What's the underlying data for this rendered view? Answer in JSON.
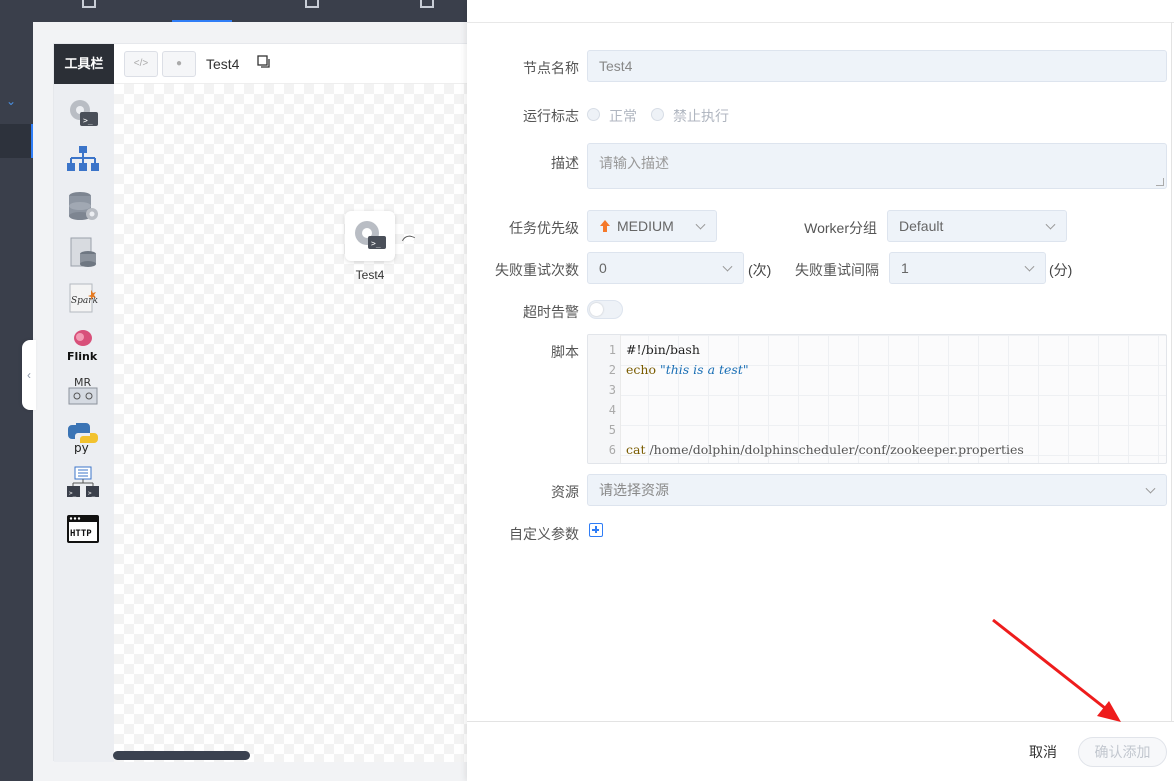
{
  "toolbar": {
    "title": "工具栏",
    "tools": [
      "shell-icon",
      "sub-process-icon",
      "procedure-icon",
      "sql-icon",
      "spark-icon",
      "flink-icon",
      "mr-icon",
      "python-icon",
      "dependent-icon",
      "http-icon"
    ],
    "flink_label": "Flink",
    "mr_label": "MR",
    "py_label": "py",
    "spark_label": "Spark",
    "http_label": "HTTP"
  },
  "dag": {
    "name": "Test4",
    "node_label": "Test4"
  },
  "form": {
    "node_name_label": "节点名称",
    "node_name_value": "Test4",
    "run_flag_label": "运行标志",
    "run_flag_normal": "正常",
    "run_flag_forbidden": "禁止执行",
    "desc_label": "描述",
    "desc_placeholder": "请输入描述",
    "priority_label": "任务优先级",
    "priority_value": "MEDIUM",
    "worker_group_label": "Worker分组",
    "worker_group_value": "Default",
    "retry_times_label": "失败重试次数",
    "retry_times_value": "0",
    "retry_times_unit": "(次)",
    "retry_interval_label": "失败重试间隔",
    "retry_interval_value": "1",
    "retry_interval_unit": "(分)",
    "timeout_label": "超时告警",
    "script_label": "脚本",
    "resource_label": "资源",
    "resource_placeholder": "请选择资源",
    "custom_params_label": "自定义参数"
  },
  "script": {
    "line_numbers": [
      "1",
      "2",
      "3",
      "4",
      "5",
      "6"
    ],
    "line1": "#!/bin/bash",
    "line2_kw": "echo",
    "line2_str": "\"this is a test\"",
    "line6_kw": "cat",
    "line6_path": "/home/dolphin/dolphinscheduler/conf/zookeeper.properties"
  },
  "footer": {
    "cancel": "取消",
    "confirm": "确认添加"
  },
  "colors": {
    "accent": "#2f7df6",
    "priority_arrow": "#f5792b",
    "annotation_arrow": "#ee1c1c"
  }
}
